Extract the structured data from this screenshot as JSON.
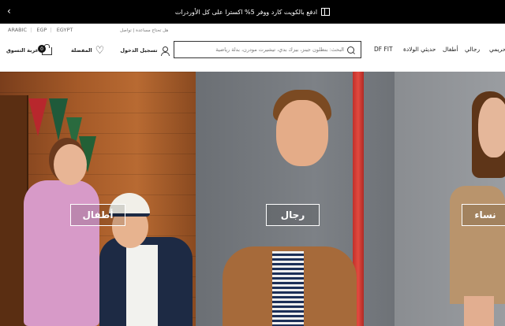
{
  "promo": {
    "text": "ادفع بالكويت كارد ووفر 5% اكسترا على كل الأوردرات",
    "arrow": "‹"
  },
  "util": {
    "language": "ARABIC",
    "currency": "EGP",
    "country": "EGYPT",
    "help": "هل تحتاج مساعدة",
    "contact": "تواصل"
  },
  "header": {
    "cart_label": "عربة التسوق",
    "cart_count": "0",
    "wishlist_label": "المفضلة",
    "login_label": "تسجيل الدخول",
    "search_placeholder": "البحث: بنطلون جينز، بيزك بدي، تيشيرت مودرن، بدلة رياضية"
  },
  "nav": {
    "df_fit": "DF FIT",
    "maternity": "حديثي الولادة",
    "kids": "أطفال",
    "men": "رجالي",
    "women": "حريمي"
  },
  "hero": {
    "kids_label": "أطفال",
    "men_label": "رجال",
    "women_label": "نساء"
  },
  "colors": {
    "promo_bg": "#000000",
    "accent_pole": "#d8453a"
  }
}
